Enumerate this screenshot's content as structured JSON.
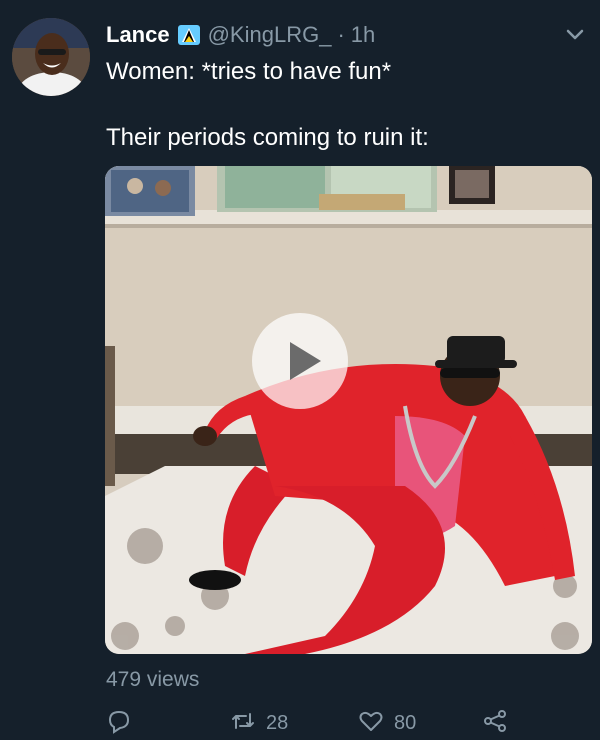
{
  "tweet": {
    "author_name": "Lance",
    "author_handle": "@KingLRG_",
    "separator": "·",
    "time": "1h",
    "line1": "Women: *tries to have fun*",
    "line2": "Their periods coming to ruin it:",
    "views": "479 views",
    "retweets": "28",
    "likes": "80"
  },
  "icons": {
    "flag": "saint-lucia-flag-icon",
    "caret": "chevron-down-icon",
    "play": "play-icon",
    "reply": "reply-icon",
    "retweet": "retweet-icon",
    "like": "heart-icon",
    "share": "share-icon"
  },
  "colors": {
    "background": "#15202b",
    "secondary_text": "#8899a6",
    "suit_red": "#e0232b"
  }
}
